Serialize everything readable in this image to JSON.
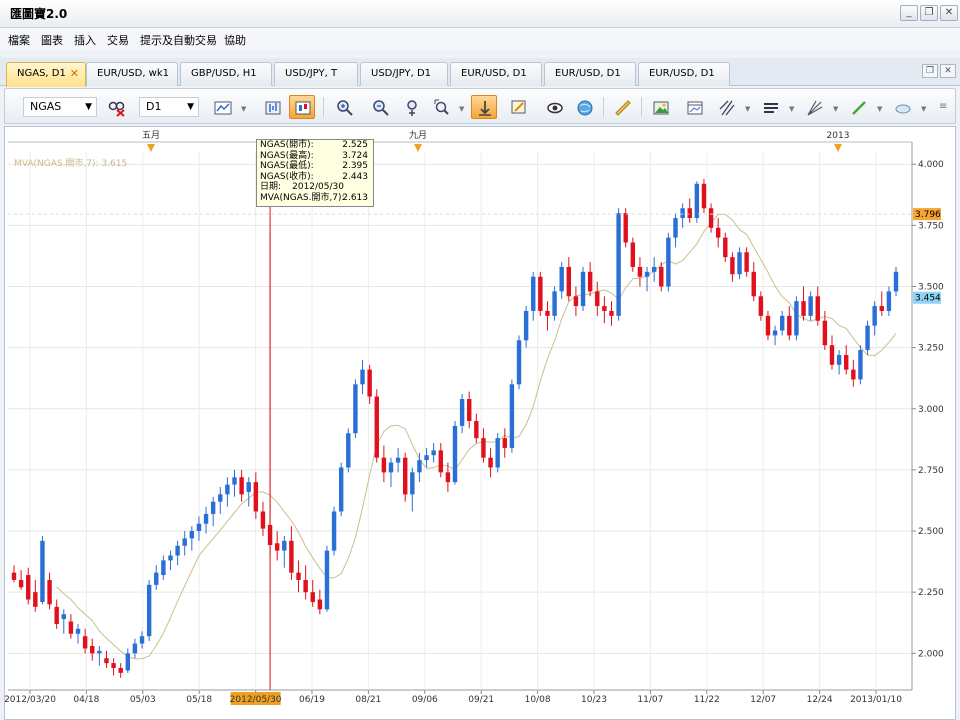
{
  "window": {
    "title": "匯圖寶2.0",
    "controls": {
      "minimize": "_",
      "restore": "❐",
      "close": "✕"
    }
  },
  "menu": [
    "檔案",
    "圖表",
    "插入",
    "交易",
    "提示及自動交易",
    "協助"
  ],
  "tabs": [
    {
      "label": "NGAS, D1",
      "active": true
    },
    {
      "label": "EUR/USD, wk1",
      "active": false
    },
    {
      "label": "GBP/USD, H1",
      "active": false
    },
    {
      "label": "USD/JPY, T",
      "active": false
    },
    {
      "label": "USD/JPY, D1",
      "active": false
    },
    {
      "label": "EUR/USD, D1",
      "active": false
    },
    {
      "label": "EUR/USD, D1",
      "active": false
    },
    {
      "label": "EUR/USD, D1",
      "active": false
    }
  ],
  "toolbar": {
    "symbol": "NGAS",
    "timeframe": "D1"
  },
  "tooltip": {
    "rows": [
      {
        "label": "NGAS(開市):",
        "value": "2.525"
      },
      {
        "label": "NGAS(最高):",
        "value": "3.724"
      },
      {
        "label": "NGAS(最低):",
        "value": "2.395"
      },
      {
        "label": "NGAS(收市):",
        "value": "2.443"
      },
      {
        "label": "日期:",
        "value": "2012/05/30"
      },
      {
        "label": "MVA(NGAS.開市,7):",
        "value": "2.613"
      }
    ]
  },
  "indicator_label": "MVA(NGAS.開市,7): 3.615",
  "colors": {
    "up": "#2a6fd6",
    "down": "#e0101c",
    "ma": "#c9c08e",
    "crosshair": "#e01010",
    "marker": "#f0a020",
    "last_price_tag": "#f7a431",
    "ma_tag": "#8fd4f4"
  },
  "chart_data": {
    "type": "candlestick",
    "instrument": "NGAS",
    "timeframe": "D1",
    "ylim": [
      1.85,
      4.05
    ],
    "y_ticks": [
      2.0,
      2.25,
      2.5,
      2.75,
      3.0,
      3.25,
      3.5,
      3.75,
      4.0
    ],
    "y_tick_labels": [
      "2.000",
      "2.250",
      "2.500",
      "2.750",
      "3.000",
      "3.250",
      "3.500",
      "3.750",
      "4.000"
    ],
    "x_labels": [
      "2012/03/20",
      "04/18",
      "05/03",
      "05/18",
      "2012/05/30",
      "06/19",
      "08/21",
      "09/06",
      "09/21",
      "10/08",
      "10/23",
      "11/07",
      "11/22",
      "12/07",
      "12/24",
      "2013/01/10"
    ],
    "highlighted_x_label": "2012/05/30",
    "top_markers": [
      "五月",
      "九月",
      "2013"
    ],
    "price_tags": [
      {
        "value": "3.796",
        "kind": "last"
      },
      {
        "value": "3.454",
        "kind": "ma"
      }
    ],
    "candles": [
      [
        2.33,
        2.36,
        2.29,
        2.3
      ],
      [
        2.3,
        2.34,
        2.26,
        2.27
      ],
      [
        2.32,
        2.35,
        2.2,
        2.22
      ],
      [
        2.25,
        2.3,
        2.17,
        2.19
      ],
      [
        2.21,
        2.48,
        2.2,
        2.46
      ],
      [
        2.3,
        2.33,
        2.18,
        2.2
      ],
      [
        2.19,
        2.22,
        2.1,
        2.12
      ],
      [
        2.14,
        2.18,
        2.08,
        2.16
      ],
      [
        2.13,
        2.16,
        2.06,
        2.08
      ],
      [
        2.08,
        2.12,
        2.04,
        2.1
      ],
      [
        2.07,
        2.1,
        2.0,
        2.02
      ],
      [
        2.03,
        2.06,
        1.97,
        2.0
      ],
      [
        2.0,
        2.03,
        1.95,
        2.01
      ],
      [
        1.98,
        2.01,
        1.94,
        1.96
      ],
      [
        1.96,
        1.98,
        1.91,
        1.94
      ],
      [
        1.94,
        1.96,
        1.9,
        1.92
      ],
      [
        1.93,
        2.02,
        1.92,
        2.0
      ],
      [
        2.0,
        2.06,
        1.98,
        2.04
      ],
      [
        2.04,
        2.09,
        2.02,
        2.07
      ],
      [
        2.07,
        2.3,
        2.05,
        2.28
      ],
      [
        2.28,
        2.36,
        2.26,
        2.33
      ],
      [
        2.32,
        2.4,
        2.3,
        2.38
      ],
      [
        2.38,
        2.42,
        2.34,
        2.4
      ],
      [
        2.4,
        2.46,
        2.36,
        2.44
      ],
      [
        2.44,
        2.5,
        2.4,
        2.47
      ],
      [
        2.47,
        2.52,
        2.42,
        2.5
      ],
      [
        2.5,
        2.56,
        2.46,
        2.53
      ],
      [
        2.53,
        2.6,
        2.49,
        2.57
      ],
      [
        2.57,
        2.64,
        2.52,
        2.62
      ],
      [
        2.62,
        2.68,
        2.57,
        2.65
      ],
      [
        2.65,
        2.72,
        2.6,
        2.69
      ],
      [
        2.69,
        2.75,
        2.64,
        2.72
      ],
      [
        2.72,
        2.75,
        2.62,
        2.65
      ],
      [
        2.66,
        2.72,
        2.6,
        2.7
      ],
      [
        2.7,
        2.74,
        2.55,
        2.58
      ],
      [
        2.58,
        2.62,
        2.48,
        2.51
      ],
      [
        2.525,
        3.724,
        2.395,
        2.443
      ],
      [
        2.45,
        2.5,
        2.38,
        2.42
      ],
      [
        2.42,
        2.48,
        2.35,
        2.46
      ],
      [
        2.46,
        2.52,
        2.3,
        2.33
      ],
      [
        2.33,
        2.38,
        2.25,
        2.3
      ],
      [
        2.3,
        2.36,
        2.22,
        2.25
      ],
      [
        2.25,
        2.3,
        2.19,
        2.21
      ],
      [
        2.22,
        2.26,
        2.16,
        2.18
      ],
      [
        2.18,
        2.44,
        2.17,
        2.42
      ],
      [
        2.42,
        2.6,
        2.4,
        2.58
      ],
      [
        2.58,
        2.78,
        2.56,
        2.76
      ],
      [
        2.76,
        2.92,
        2.74,
        2.9
      ],
      [
        2.9,
        3.12,
        2.88,
        3.1
      ],
      [
        3.1,
        3.2,
        3.06,
        3.16
      ],
      [
        3.16,
        3.18,
        3.02,
        3.05
      ],
      [
        3.05,
        3.08,
        2.78,
        2.8
      ],
      [
        2.8,
        2.85,
        2.7,
        2.74
      ],
      [
        2.74,
        2.8,
        2.68,
        2.78
      ],
      [
        2.78,
        2.84,
        2.74,
        2.8
      ],
      [
        2.8,
        2.82,
        2.62,
        2.65
      ],
      [
        2.65,
        2.76,
        2.58,
        2.74
      ],
      [
        2.74,
        2.82,
        2.7,
        2.79
      ],
      [
        2.79,
        2.84,
        2.76,
        2.81
      ],
      [
        2.81,
        2.86,
        2.78,
        2.83
      ],
      [
        2.83,
        2.86,
        2.72,
        2.74
      ],
      [
        2.74,
        2.78,
        2.66,
        2.7
      ],
      [
        2.7,
        2.95,
        2.69,
        2.93
      ],
      [
        2.93,
        3.06,
        2.9,
        3.04
      ],
      [
        3.04,
        3.07,
        2.92,
        2.95
      ],
      [
        2.95,
        2.98,
        2.86,
        2.88
      ],
      [
        2.88,
        2.92,
        2.78,
        2.8
      ],
      [
        2.8,
        2.84,
        2.72,
        2.76
      ],
      [
        2.76,
        2.9,
        2.74,
        2.88
      ],
      [
        2.88,
        2.92,
        2.8,
        2.84
      ],
      [
        2.84,
        3.12,
        2.82,
        3.1
      ],
      [
        3.1,
        3.3,
        3.08,
        3.28
      ],
      [
        3.28,
        3.42,
        3.25,
        3.4
      ],
      [
        3.4,
        3.56,
        3.36,
        3.54
      ],
      [
        3.54,
        3.56,
        3.38,
        3.4
      ],
      [
        3.4,
        3.44,
        3.32,
        3.38
      ],
      [
        3.38,
        3.5,
        3.36,
        3.48
      ],
      [
        3.48,
        3.6,
        3.45,
        3.58
      ],
      [
        3.58,
        3.62,
        3.44,
        3.46
      ],
      [
        3.46,
        3.5,
        3.38,
        3.42
      ],
      [
        3.42,
        3.58,
        3.4,
        3.56
      ],
      [
        3.56,
        3.6,
        3.46,
        3.48
      ],
      [
        3.48,
        3.52,
        3.38,
        3.42
      ],
      [
        3.42,
        3.46,
        3.35,
        3.4
      ],
      [
        3.4,
        3.44,
        3.34,
        3.38
      ],
      [
        3.38,
        3.82,
        3.36,
        3.8
      ],
      [
        3.8,
        3.82,
        3.66,
        3.68
      ],
      [
        3.68,
        3.7,
        3.56,
        3.58
      ],
      [
        3.58,
        3.62,
        3.5,
        3.54
      ],
      [
        3.54,
        3.58,
        3.48,
        3.56
      ],
      [
        3.56,
        3.62,
        3.52,
        3.58
      ],
      [
        3.58,
        3.6,
        3.48,
        3.5
      ],
      [
        3.5,
        3.72,
        3.48,
        3.7
      ],
      [
        3.7,
        3.8,
        3.66,
        3.78
      ],
      [
        3.78,
        3.84,
        3.74,
        3.82
      ],
      [
        3.82,
        3.86,
        3.76,
        3.78
      ],
      [
        3.78,
        3.93,
        3.76,
        3.92
      ],
      [
        3.92,
        3.94,
        3.8,
        3.82
      ],
      [
        3.82,
        3.84,
        3.72,
        3.74
      ],
      [
        3.74,
        3.78,
        3.66,
        3.7
      ],
      [
        3.7,
        3.72,
        3.6,
        3.62
      ],
      [
        3.62,
        3.64,
        3.52,
        3.55
      ],
      [
        3.55,
        3.66,
        3.53,
        3.64
      ],
      [
        3.64,
        3.66,
        3.54,
        3.56
      ],
      [
        3.56,
        3.6,
        3.44,
        3.46
      ],
      [
        3.46,
        3.48,
        3.36,
        3.38
      ],
      [
        3.38,
        3.4,
        3.28,
        3.3
      ],
      [
        3.3,
        3.34,
        3.26,
        3.32
      ],
      [
        3.32,
        3.4,
        3.3,
        3.38
      ],
      [
        3.38,
        3.42,
        3.28,
        3.3
      ],
      [
        3.3,
        3.46,
        3.28,
        3.44
      ],
      [
        3.44,
        3.5,
        3.36,
        3.38
      ],
      [
        3.38,
        3.48,
        3.36,
        3.46
      ],
      [
        3.46,
        3.5,
        3.34,
        3.36
      ],
      [
        3.36,
        3.4,
        3.24,
        3.26
      ],
      [
        3.26,
        3.3,
        3.16,
        3.18
      ],
      [
        3.18,
        3.24,
        3.14,
        3.22
      ],
      [
        3.22,
        3.26,
        3.14,
        3.16
      ],
      [
        3.16,
        3.2,
        3.09,
        3.12
      ],
      [
        3.12,
        3.26,
        3.1,
        3.24
      ],
      [
        3.24,
        3.36,
        3.22,
        3.34
      ],
      [
        3.34,
        3.44,
        3.3,
        3.42
      ],
      [
        3.42,
        3.48,
        3.38,
        3.4
      ],
      [
        3.4,
        3.5,
        3.38,
        3.48
      ],
      [
        3.48,
        3.58,
        3.46,
        3.56
      ]
    ]
  }
}
